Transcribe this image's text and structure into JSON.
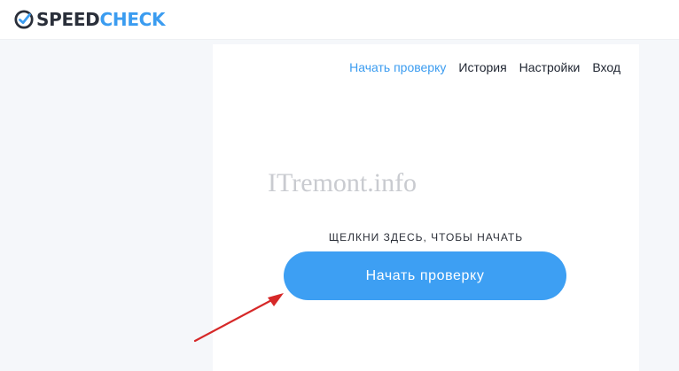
{
  "header": {
    "logo_speed": "SPEED",
    "logo_check": "CHECK",
    "logo_icon": "speedometer-check-icon"
  },
  "nav": {
    "items": [
      {
        "label": "Начать проверку",
        "active": true
      },
      {
        "label": "История",
        "active": false
      },
      {
        "label": "Настройки",
        "active": false
      },
      {
        "label": "Вход",
        "active": false
      }
    ]
  },
  "main": {
    "watermark": "ITremont.info",
    "hint": "ЩЕЛКНИ ЗДЕСЬ, ЧТОБЫ НАЧАТЬ",
    "start_button_label": "Начать проверку"
  },
  "colors": {
    "accent": "#3d9ff3",
    "arrow": "#d62828",
    "text": "#1e2430"
  }
}
